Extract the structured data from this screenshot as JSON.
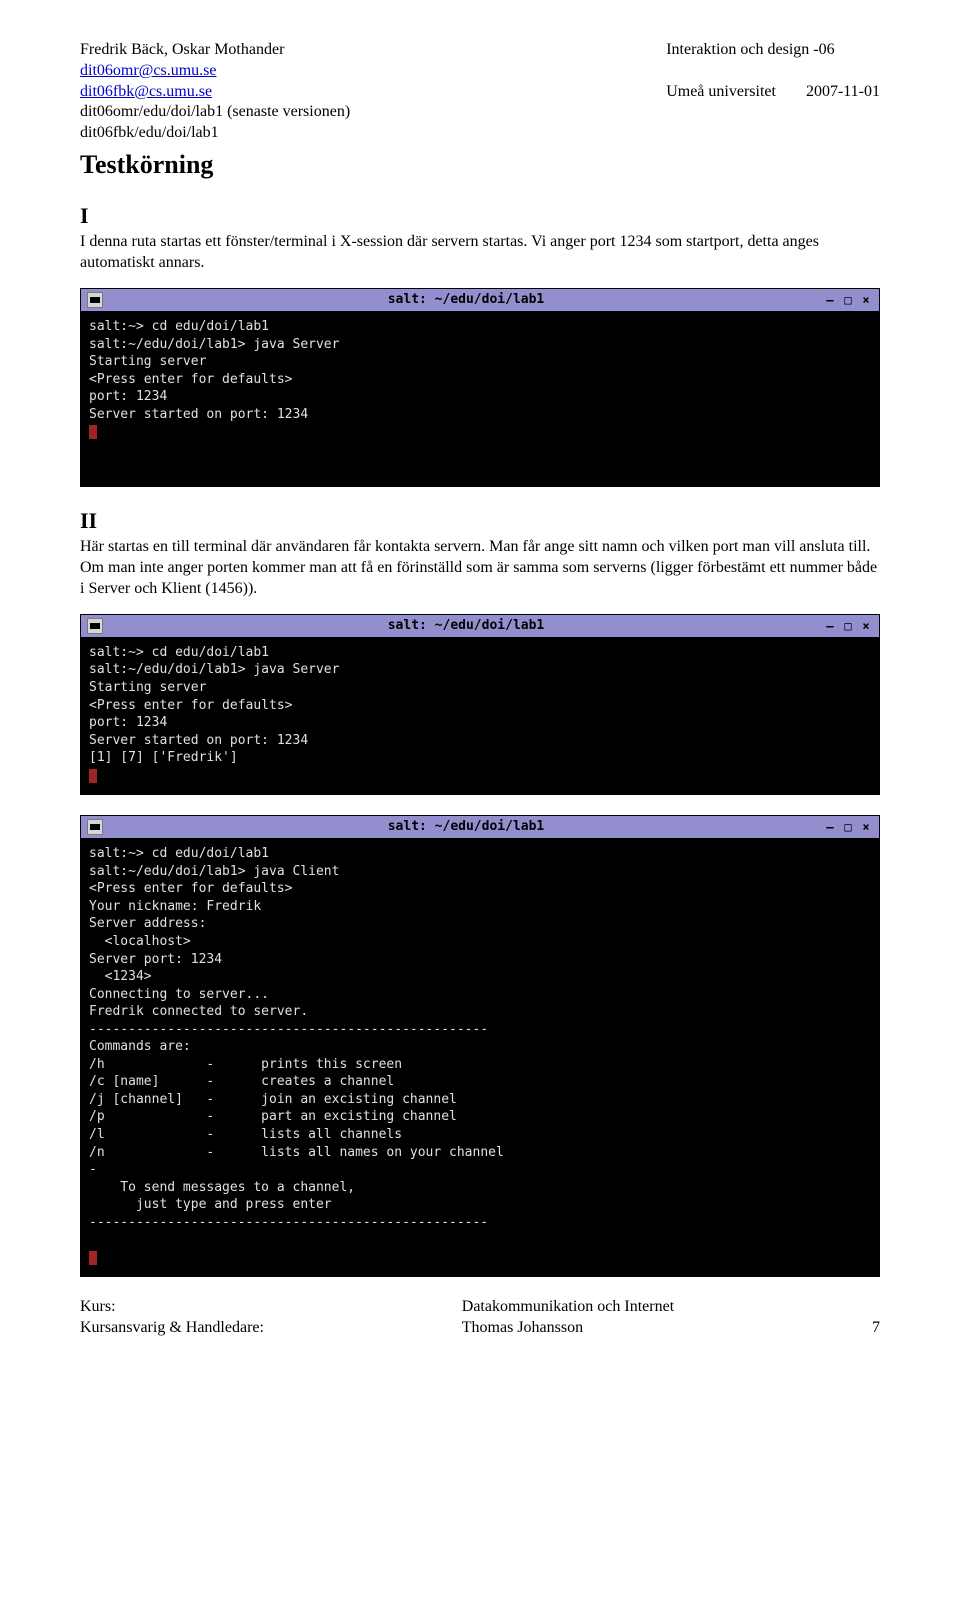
{
  "header": {
    "names": "Fredrik Bäck, Oskar Mothander",
    "email1": "dit06omr@cs.umu.se",
    "email2": "dit06fbk@cs.umu.se",
    "path1": "dit06omr/edu/doi/lab1 (senaste versionen)",
    "path2": "dit06fbk/edu/doi/lab1",
    "course": "Interaktion och design -06",
    "uni": "Umeå universitet",
    "date": "2007-11-01"
  },
  "title": "Testkörning",
  "section1": {
    "heading": "I",
    "text": "I denna ruta startas ett fönster/terminal i X-session där servern startas. Vi anger port 1234 som startport, detta anges automatiskt annars."
  },
  "section2": {
    "heading": "II",
    "text": "Här startas en till terminal där användaren får kontakta servern. Man får ange sitt namn och vilken port man vill ansluta till. Om man inte anger porten kommer man att få en förinställd som är samma som serverns (ligger förbestämt ett nummer både i Server och Klient (1456))."
  },
  "terminals": {
    "title": "salt: ~/edu/doi/lab1",
    "t1": "salt:~> cd edu/doi/lab1\nsalt:~/edu/doi/lab1> java Server\nStarting server\n<Press enter for defaults>\nport: 1234\nServer started on port: 1234",
    "t2": "salt:~> cd edu/doi/lab1\nsalt:~/edu/doi/lab1> java Server\nStarting server\n<Press enter for defaults>\nport: 1234\nServer started on port: 1234\n[1] [7] ['Fredrik']",
    "t3": "salt:~> cd edu/doi/lab1\nsalt:~/edu/doi/lab1> java Client\n<Press enter for defaults>\nYour nickname: Fredrik\nServer address:\n  <localhost>\nServer port: 1234\n  <1234>\nConnecting to server...\nFredrik connected to server.\n---------------------------------------------------\nCommands are:\n/h             -      prints this screen\n/c [name]      -      creates a channel\n/j [channel]   -      join an excisting channel\n/p             -      part an excisting channel\n/l             -      lists all channels\n/n             -      lists all names on your channel\n-\n    To send messages to a channel,\n      just type and press enter\n---------------------------------------------------"
  },
  "winbtns": {
    "min": "–",
    "max": "□",
    "close": "×"
  },
  "footer": {
    "l1": "Kurs:",
    "l2": "Kursansvarig & Handledare:",
    "c1": "Datakommunikation och Internet",
    "c2": "Thomas Johansson",
    "page": "7"
  }
}
